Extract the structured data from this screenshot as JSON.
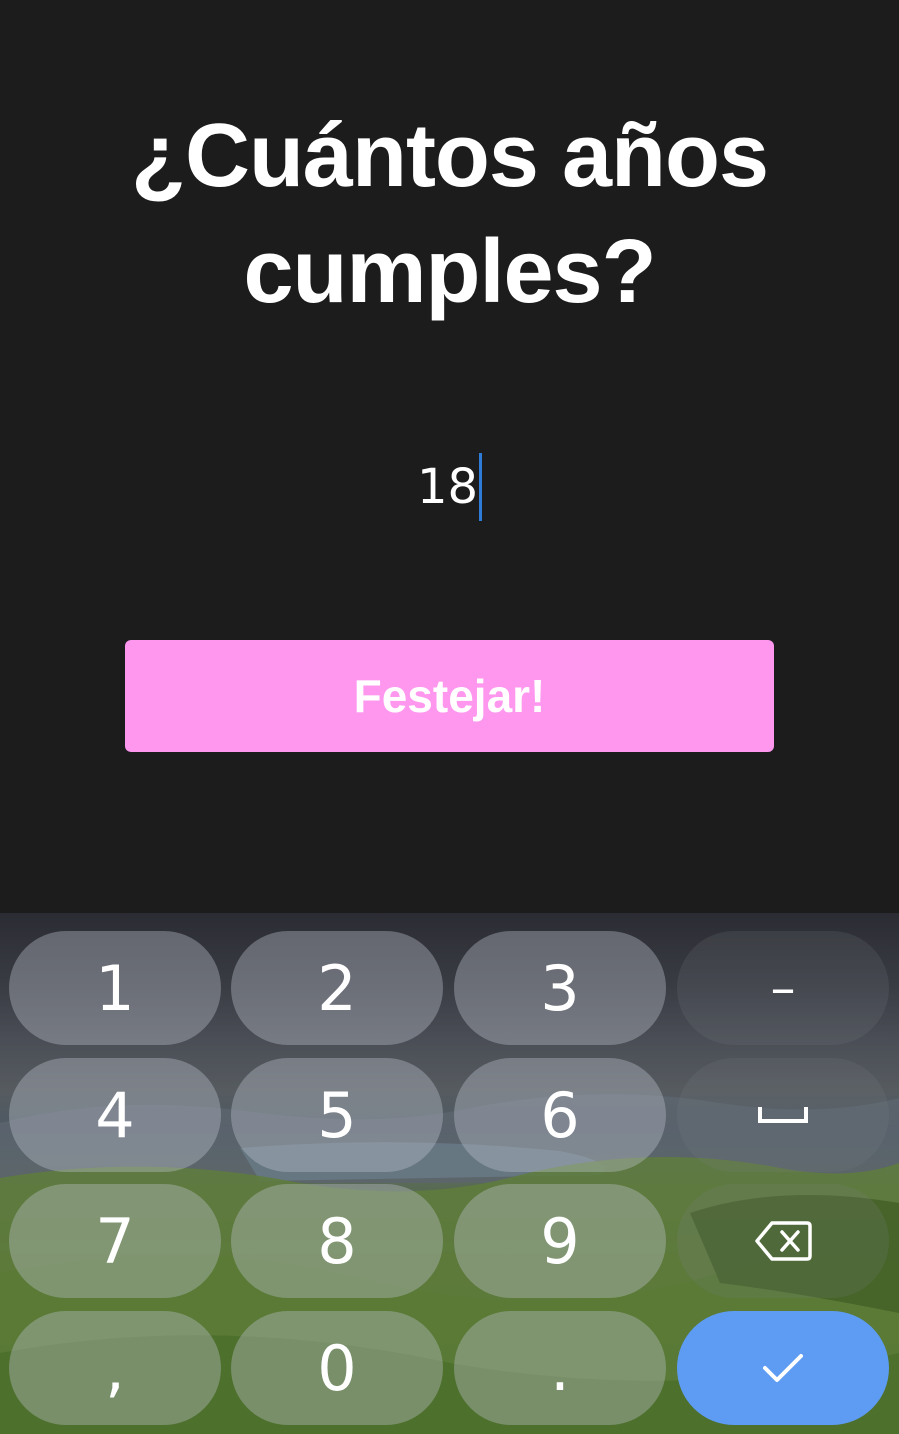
{
  "screen": {
    "question": "¿Cuántos años cumples?",
    "age_value": "18",
    "submit_label": "Festejar!"
  },
  "colors": {
    "background": "#1c1c1d",
    "button": "#ff97ef",
    "caret": "#2f7cd6",
    "done_key": "#5e9cf3"
  },
  "keyboard": {
    "keys": {
      "k1": "1",
      "k2": "2",
      "k3": "3",
      "k4": "4",
      "k5": "5",
      "k6": "6",
      "k7": "7",
      "k8": "8",
      "k9": "9",
      "k0": "0",
      "comma": ",",
      "period": ".",
      "minus": "–"
    },
    "icons": {
      "space": "space-bar-icon",
      "backspace": "backspace-icon",
      "done": "checkmark-icon"
    }
  }
}
